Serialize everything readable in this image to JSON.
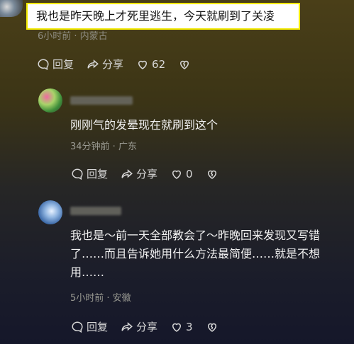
{
  "top_comment": {
    "text": "我也是昨天晚上才死里逃生，今天就刷到了关凌",
    "meta": "6小时前 · 内蒙古",
    "actions": {
      "reply": "回复",
      "share": "分享",
      "likes": "62"
    }
  },
  "comments": [
    {
      "text": "刚刚气的发晕现在就刷到这个",
      "meta": "34分钟前 · 广东",
      "actions": {
        "reply": "回复",
        "share": "分享",
        "likes": "0"
      }
    },
    {
      "text_lines": [
        "我也是～前一天全部教会了～昨晚回来发现又写错",
        "了……而且告诉她用什么方法最简便……就是不想",
        "用……"
      ],
      "meta": "5小时前 · 安徽",
      "actions": {
        "reply": "回复",
        "share": "分享",
        "likes": "3"
      }
    }
  ],
  "colors": {
    "highlight_border": "#f2e900",
    "text": "#f1f1f1",
    "meta": "#9a9a92"
  }
}
